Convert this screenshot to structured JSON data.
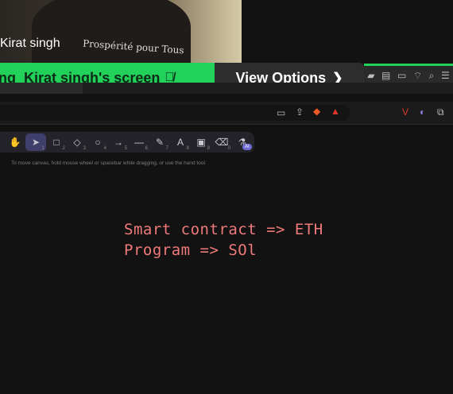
{
  "webcam": {
    "participant_name": "Kirat singh",
    "shirt_text": "Prospérité pour Tous"
  },
  "share_bar": {
    "prefix": "ng",
    "label": "Kirat singh's screen",
    "mic_icon": "mic-muted-icon",
    "view_options_label": "View Options",
    "accent": "#21d15a"
  },
  "toolbar": {
    "tools": [
      {
        "icon": "hand-icon",
        "glyph": "✋",
        "key": ""
      },
      {
        "icon": "pointer-icon",
        "glyph": "➤",
        "key": "1"
      },
      {
        "icon": "rectangle-icon",
        "glyph": "□",
        "key": "2"
      },
      {
        "icon": "diamond-icon",
        "glyph": "◇",
        "key": "3"
      },
      {
        "icon": "ellipse-icon",
        "glyph": "○",
        "key": "4"
      },
      {
        "icon": "arrow-icon",
        "glyph": "→",
        "key": "5"
      },
      {
        "icon": "line-icon",
        "glyph": "—",
        "key": "6"
      },
      {
        "icon": "pencil-icon",
        "glyph": "✎",
        "key": "7"
      },
      {
        "icon": "text-icon",
        "glyph": "A",
        "key": "8"
      },
      {
        "icon": "image-icon",
        "glyph": "▣",
        "key": "9"
      },
      {
        "icon": "eraser-icon",
        "glyph": "⌫",
        "key": "0"
      },
      {
        "icon": "ai-tools-icon",
        "glyph": "⚗",
        "key": ""
      }
    ],
    "active_index": 1,
    "ai_badge": "AI"
  },
  "canvas": {
    "hint": "To move canvas, hold mouse wheel or spacebar while dragging, or use the hand tool.",
    "lines": [
      "Smart contract => ETH",
      "Program => SOl"
    ],
    "ink_color": "#f07a7a"
  }
}
